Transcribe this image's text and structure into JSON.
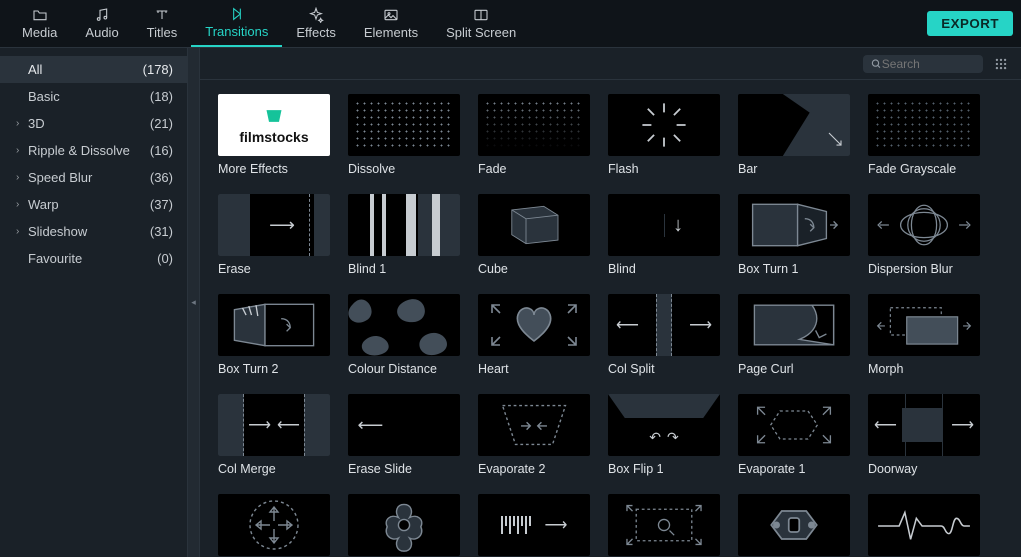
{
  "tabs": [
    {
      "label": "Media",
      "icon": "folder-icon"
    },
    {
      "label": "Audio",
      "icon": "music-icon"
    },
    {
      "label": "Titles",
      "icon": "type-icon"
    },
    {
      "label": "Transitions",
      "icon": "transition-icon",
      "active": true
    },
    {
      "label": "Effects",
      "icon": "sparkle-icon"
    },
    {
      "label": "Elements",
      "icon": "image-icon"
    },
    {
      "label": "Split Screen",
      "icon": "splitscreen-icon"
    }
  ],
  "export_label": "EXPORT",
  "search_placeholder": "Search",
  "sidebar": [
    {
      "label": "All",
      "count": "(178)",
      "expandable": false,
      "selected": true
    },
    {
      "label": "Basic",
      "count": "(18)",
      "expandable": false
    },
    {
      "label": "3D",
      "count": "(21)",
      "expandable": true
    },
    {
      "label": "Ripple & Dissolve",
      "count": "(16)",
      "expandable": true
    },
    {
      "label": "Speed Blur",
      "count": "(36)",
      "expandable": true
    },
    {
      "label": "Warp",
      "count": "(37)",
      "expandable": true
    },
    {
      "label": "Slideshow",
      "count": "(31)",
      "expandable": true
    },
    {
      "label": "Favourite",
      "count": "(0)",
      "expandable": false
    }
  ],
  "items": [
    {
      "name": "More Effects",
      "variant": "filmstocks"
    },
    {
      "name": "Dissolve",
      "variant": "dotgrid"
    },
    {
      "name": "Fade",
      "variant": "dotgrid fade"
    },
    {
      "name": "Flash",
      "variant": "flashrays"
    },
    {
      "name": "Bar",
      "variant": "bar-th"
    },
    {
      "name": "Fade Grayscale",
      "variant": "dotgrid dark"
    },
    {
      "name": "Erase",
      "variant": "erase-th"
    },
    {
      "name": "Blind 1",
      "variant": "blind1"
    },
    {
      "name": "Cube",
      "variant": "cube-th"
    },
    {
      "name": "Blind",
      "variant": "blind-th"
    },
    {
      "name": "Box Turn 1",
      "variant": "boxturn"
    },
    {
      "name": "Dispersion Blur",
      "variant": "disp-th"
    },
    {
      "name": "Box Turn 2",
      "variant": "boxturn2"
    },
    {
      "name": "Colour Distance",
      "variant": "blobs"
    },
    {
      "name": "Heart",
      "variant": "heart-th"
    },
    {
      "name": "Col Split",
      "variant": "colsplit"
    },
    {
      "name": "Page Curl",
      "variant": "pagecurl"
    },
    {
      "name": "Morph",
      "variant": "morph"
    },
    {
      "name": "Col Merge",
      "variant": "colmerge"
    },
    {
      "name": "Erase Slide",
      "variant": "eraseslide"
    },
    {
      "name": "Evaporate 2",
      "variant": "evap"
    },
    {
      "name": "Box Flip 1",
      "variant": "boxflip"
    },
    {
      "name": "Evaporate 1",
      "variant": "evap1"
    },
    {
      "name": "Doorway",
      "variant": "doorway"
    },
    {
      "name": "",
      "variant": "cross-arrows"
    },
    {
      "name": "",
      "variant": "flower"
    },
    {
      "name": "",
      "variant": "barcode"
    },
    {
      "name": "",
      "variant": "zoomcorners"
    },
    {
      "name": "",
      "variant": "hexthumb"
    },
    {
      "name": "",
      "variant": "ecg"
    }
  ]
}
